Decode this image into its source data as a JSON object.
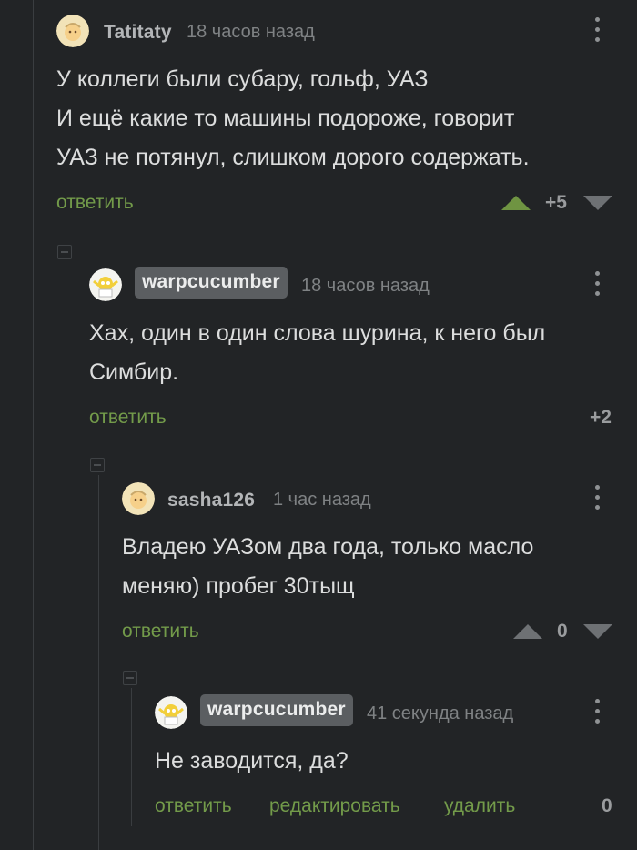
{
  "comments": [
    {
      "username": "Tatitaty",
      "time": "18 часов назад",
      "text": "У коллеги были субару, гольф, УАЗ\nИ ещё какие то машины подороже, говорит\nУАЗ не потянул, слишком дорого содержать.",
      "reply": "ответить",
      "rating": "+5"
    },
    {
      "username": "warpcucumber",
      "time": "18 часов назад",
      "text": "Хах, один в один слова шурина, к него был\nСимбир.",
      "reply": "ответить",
      "rating": "+2"
    },
    {
      "username": "sasha126",
      "time": "1 час назад",
      "text": "Владею УАЗом два года, только масло\nменяю) пробег 30тыщ",
      "reply": "ответить",
      "rating": "0"
    },
    {
      "username": "warpcucumber",
      "time": "41 секунда назад",
      "text": "Не заводится, да?",
      "reply": "ответить",
      "edit": "редактировать",
      "delete": "удалить",
      "rating": "0"
    }
  ],
  "colors": {
    "background": "#222426",
    "action_green": "#739b4a",
    "upvote_green": "#6f9442",
    "badge_bg": "#5b5e61"
  },
  "icons": [
    "menu-dots-icon",
    "upvote-arrow-icon",
    "downvote-arrow-icon",
    "collapse-thread-icon",
    "avatar"
  ]
}
